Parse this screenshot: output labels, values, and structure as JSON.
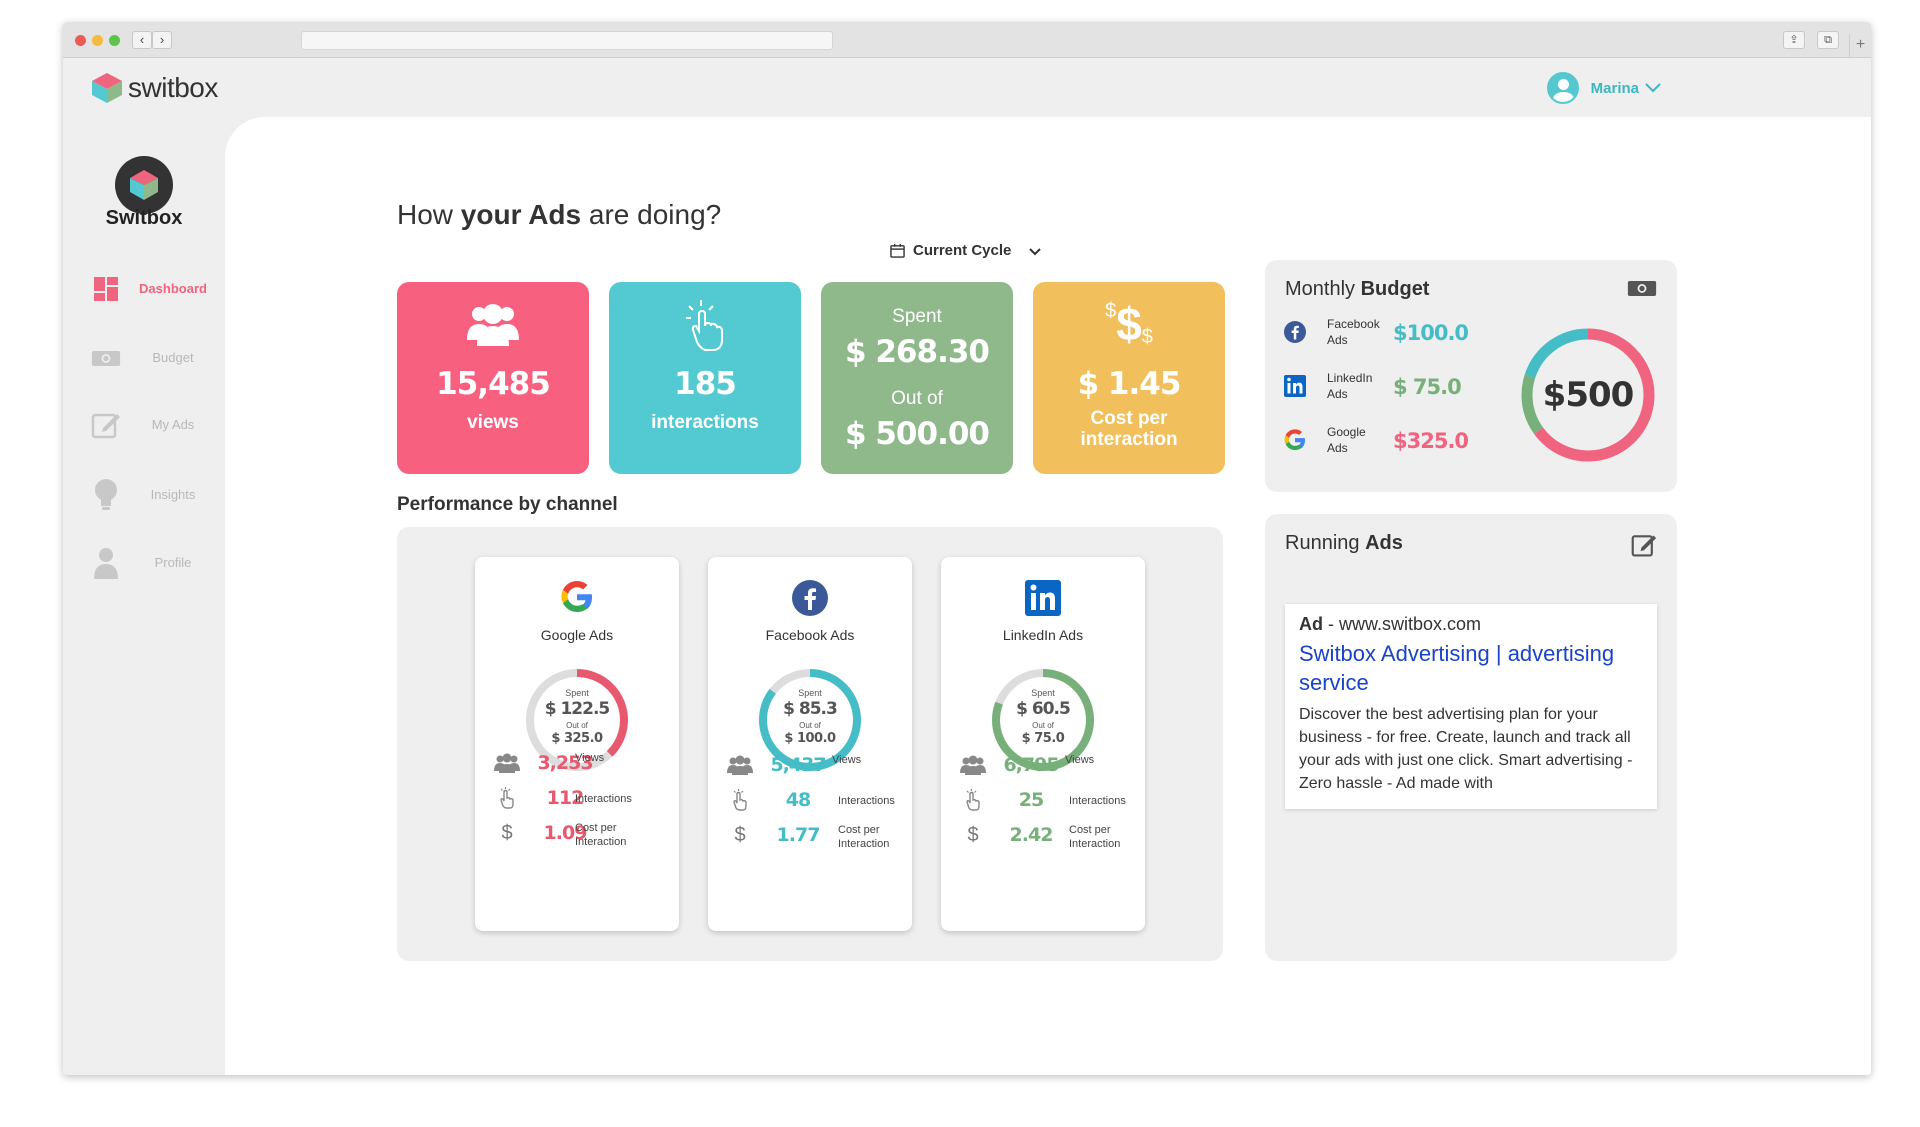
{
  "app": {
    "logo_text": "switbox",
    "user_name": "Marina"
  },
  "sidebar": {
    "brand": "Switbox",
    "items": [
      {
        "label": "Dashboard",
        "icon": "dashboard-icon",
        "active": true
      },
      {
        "label": "Budget",
        "icon": "money-icon",
        "active": false
      },
      {
        "label": "My Ads",
        "icon": "edit-icon",
        "active": false
      },
      {
        "label": "Insights",
        "icon": "lightbulb-icon",
        "active": false
      },
      {
        "label": "Profile",
        "icon": "user-icon",
        "active": false
      }
    ]
  },
  "header": {
    "title_pre": "How ",
    "title_bold": "your Ads",
    "title_post": " are doing?",
    "cycle_label": "Current Cycle"
  },
  "stats": [
    {
      "value": "15,485",
      "label": "views",
      "color": "#f8607f"
    },
    {
      "value": "185",
      "label": "interactions",
      "color": "#53c9d1"
    },
    {
      "spent_label": "Spent",
      "spent": "$ 268.30",
      "out_label": "Out of",
      "total": "$ 500.00",
      "color": "#8fb98b"
    },
    {
      "value": "$ 1.45",
      "label": "Cost per interaction",
      "color": "#f1c05c"
    }
  ],
  "performance": {
    "title": "Performance by channel",
    "channels": [
      {
        "name": "Google Ads",
        "icon": "google-icon",
        "color": "#e8586f",
        "spent_label": "Spent",
        "spent": "$ 122.5",
        "out_label": "Out of",
        "total": "$ 325.0",
        "fraction": 0.377,
        "views": "3,253",
        "views_label": "Views",
        "interactions": "112",
        "interactions_label": "Interactions",
        "cpi": "1.09",
        "cpi_label": "Cost per Interaction"
      },
      {
        "name": "Facebook Ads",
        "icon": "facebook-icon",
        "color": "#45bdc7",
        "spent_label": "Spent",
        "spent": "$ 85.3",
        "out_label": "Out of",
        "total": "$ 100.0",
        "fraction": 0.853,
        "views": "5,437",
        "views_label": "Views",
        "interactions": "48",
        "interactions_label": "Interactions",
        "cpi": "1.77",
        "cpi_label": "Cost per Interaction"
      },
      {
        "name": "LinkedIn Ads",
        "icon": "linkedin-icon",
        "color": "#77b07a",
        "spent_label": "Spent",
        "spent": "$ 60.5",
        "out_label": "Out of",
        "total": "$ 75.0",
        "fraction": 0.807,
        "views": "6,795",
        "views_label": "Views",
        "interactions": "25",
        "interactions_label": "Interactions",
        "cpi": "2.42",
        "cpi_label": "Cost per Interaction"
      }
    ]
  },
  "budget": {
    "title_pre": "Monthly ",
    "title_bold": "Budget",
    "total": "$500",
    "items": [
      {
        "name_line1": "Facebook",
        "name_line2": "Ads",
        "value": "$100.0",
        "color": "#45bdc7",
        "amount": 100
      },
      {
        "name_line1": "LinkedIn",
        "name_line2": "Ads",
        "value": "$ 75.0",
        "color": "#77b07a",
        "amount": 75
      },
      {
        "name_line1": "Google",
        "name_line2": "Ads",
        "value": "$325.0",
        "color": "#f0647f",
        "amount": 325
      }
    ]
  },
  "running": {
    "title_pre": "Running ",
    "title_bold": "Ads",
    "ad_label": "Ad",
    "ad_url": " - www.switbox.com",
    "ad_title": "Switbox Advertising | advertising service",
    "ad_desc": "Discover the best advertising plan for your business - for free. Create, launch and track all your ads with just one click. Smart advertising - Zero hassle - Ad made with"
  }
}
